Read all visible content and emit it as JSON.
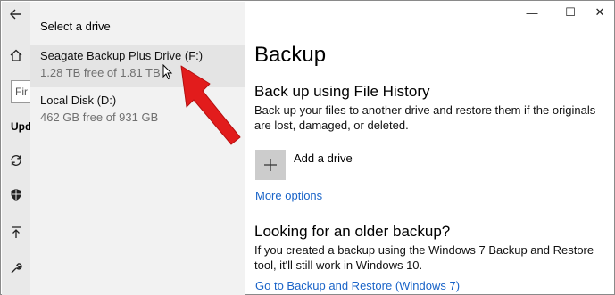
{
  "colors": {
    "link": "#1a64c8",
    "annotation_arrow": "#e21c1c",
    "rail_bg": "#e9e9e9",
    "flyout_bg": "#f2f2f2"
  },
  "rail": {
    "search_text": "Fir",
    "section_label": "Upd",
    "icons": [
      "back-arrow-icon",
      "home-icon",
      "sync-icon",
      "shield-icon",
      "upload-icon",
      "wrench-icon"
    ]
  },
  "flyout": {
    "title": "Select a drive",
    "drives": [
      {
        "name": "Seagate Backup Plus Drive (F:)",
        "size": "1.28 TB free of 1.81 TB"
      },
      {
        "name": "Local Disk (D:)",
        "size": "462 GB free of 931 GB"
      }
    ]
  },
  "window_controls": {
    "minimize": "—",
    "maximize": "☐",
    "close": "✕"
  },
  "main": {
    "page_title": "Backup",
    "file_history": {
      "heading": "Back up using File History",
      "description": "Back up your files to another drive and restore them if the originals are lost, damaged, or deleted.",
      "add_drive_label": "Add a drive",
      "more_options": "More options"
    },
    "older_backup": {
      "heading": "Looking for an older backup?",
      "description": "If you created a backup using the Windows 7 Backup and Restore tool, it'll still work in Windows 10.",
      "link": "Go to Backup and Restore (Windows 7)"
    }
  }
}
